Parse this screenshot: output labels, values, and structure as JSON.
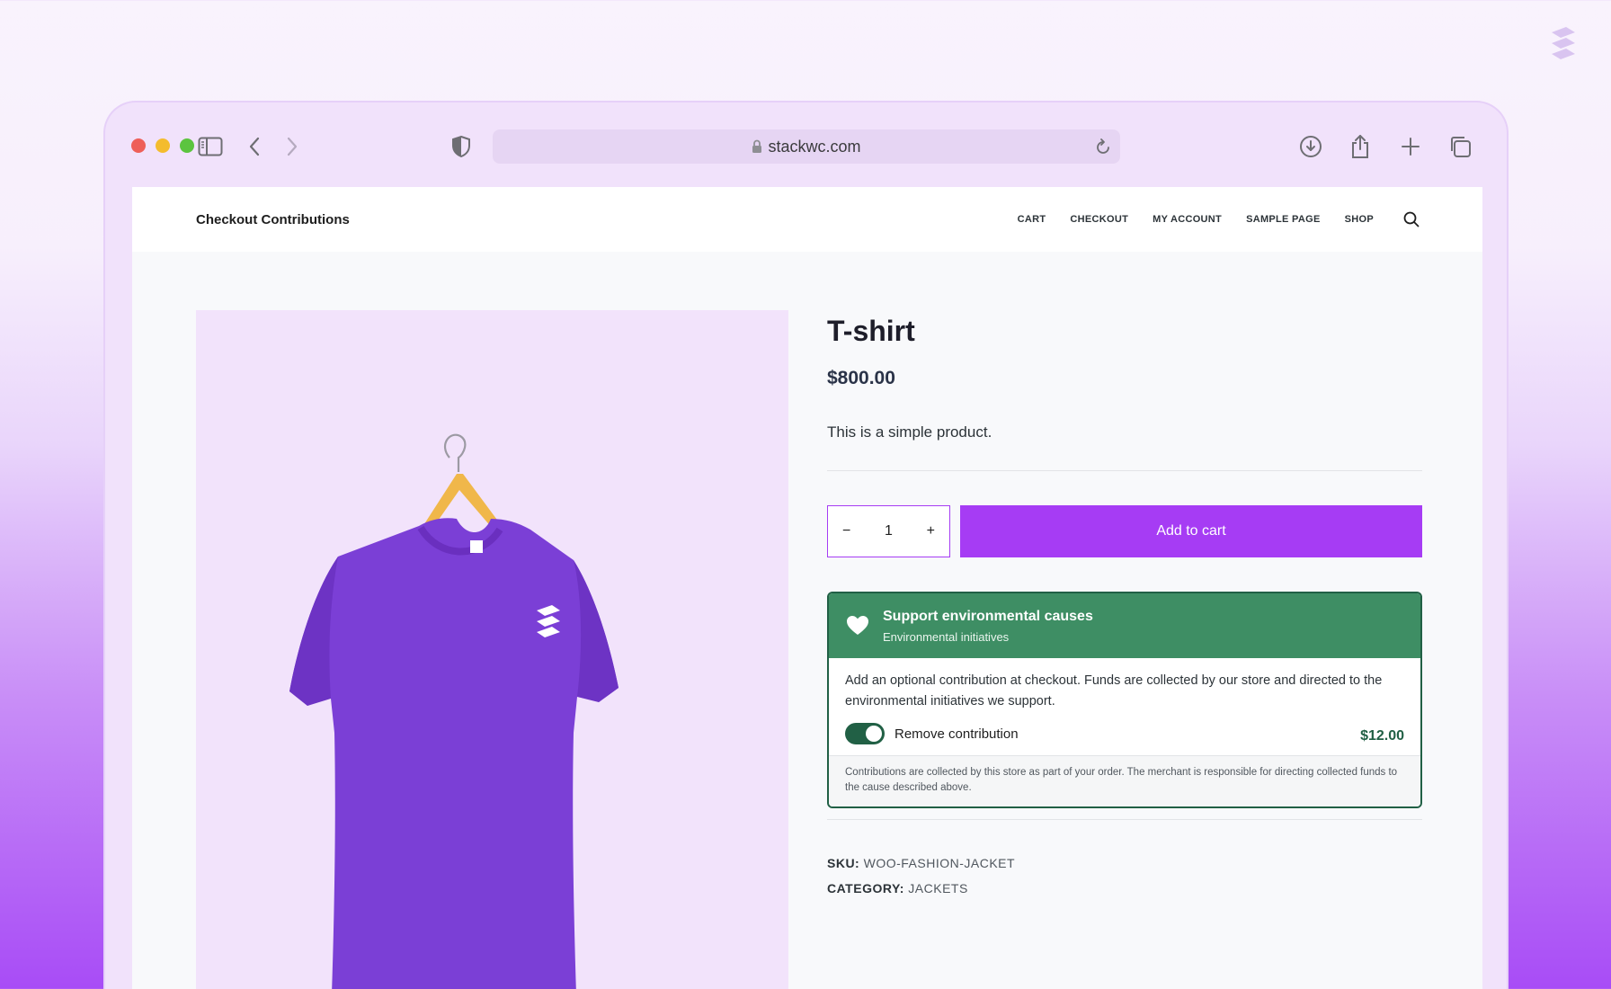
{
  "browser": {
    "url": "stackwc.com"
  },
  "site": {
    "title": "Checkout Contributions",
    "nav": [
      "CART",
      "CHECKOUT",
      "MY ACCOUNT",
      "SAMPLE PAGE",
      "SHOP"
    ]
  },
  "product": {
    "title": "T-shirt",
    "price": "$800.00",
    "description": "This is a simple product.",
    "quantity": "1",
    "qty_minus": "−",
    "qty_plus": "+",
    "add_to_cart": "Add to cart",
    "sku_label": "SKU:",
    "sku": "WOO-FASHION-JACKET",
    "category_label": "CATEGORY:",
    "category": "JACKETS"
  },
  "contribution": {
    "title": "Support environmental causes",
    "subtitle": "Environmental initiatives",
    "body": "Add an optional contribution at checkout. Funds are collected by our store and directed to the environmental initiatives we support.",
    "toggle_label": "Remove contribution",
    "toggle_on": true,
    "amount": "$12.00",
    "footnote": "Contributions are collected by this store as part of your order. The merchant is responsible for directing collected funds to the cause described above."
  },
  "colors": {
    "accent": "#a63cf4",
    "contribution_header": "#3e8e64",
    "contribution_dark": "#216045"
  },
  "icons": [
    "brand-logo-icon",
    "sidebar-icon",
    "back-icon",
    "forward-icon",
    "shield-icon",
    "lock-icon",
    "reload-icon",
    "download-icon",
    "share-icon",
    "new-tab-icon",
    "tabs-overview-icon",
    "search-icon",
    "heart-icon"
  ]
}
